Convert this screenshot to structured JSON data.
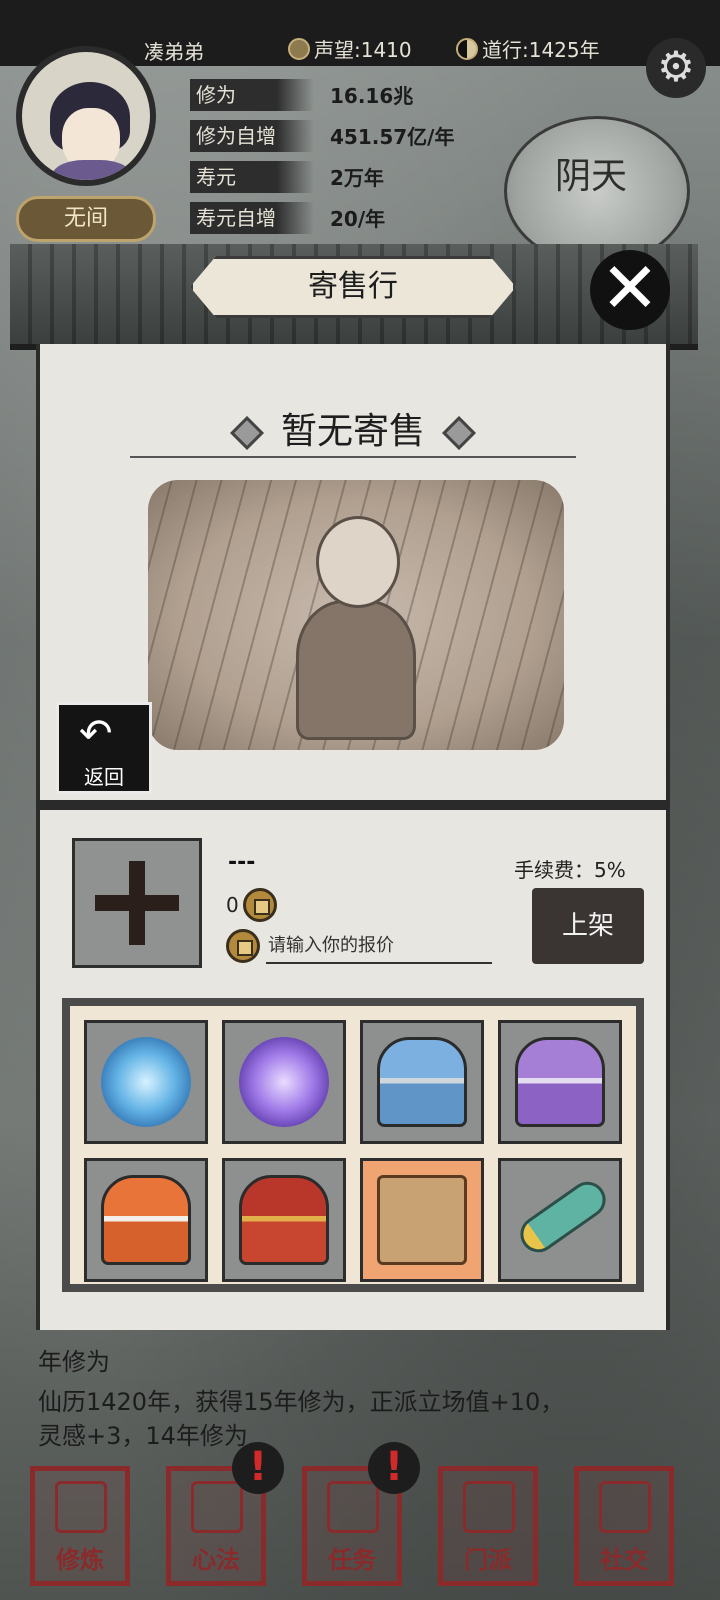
{
  "header": {
    "player_name": "凑弟弟",
    "reputation_label": "声望:1410",
    "dao_label": "道行:1425年",
    "title_badge": "无间"
  },
  "stats": [
    {
      "label": "修为",
      "value": "16.16兆"
    },
    {
      "label": "修为自增",
      "value": "451.57亿/年"
    },
    {
      "label": "寿元",
      "value": "2万年"
    },
    {
      "label": "寿元自增",
      "value": "20/年"
    }
  ],
  "weather": "阴天",
  "panel": {
    "title": "寄售行",
    "empty_title": "暂无寄售",
    "back_label": "返回"
  },
  "listing": {
    "item_name": "---",
    "price": "0",
    "price_placeholder": "请输入你的报价",
    "fee": "手续费：5%",
    "list_button": "上架"
  },
  "inventory": [
    {
      "icon": "blue-portal-icon"
    },
    {
      "icon": "purple-portal-icon"
    },
    {
      "icon": "blue-chest-icon"
    },
    {
      "icon": "purple-chest-icon"
    },
    {
      "icon": "orange-chest-icon"
    },
    {
      "icon": "gold-chest-icon"
    },
    {
      "icon": "map-scroll-icon"
    },
    {
      "icon": "jade-scroll-icon"
    }
  ],
  "log": {
    "line1": "年修为",
    "line2": "仙历1420年，获得15年修为，正派立场值+10，",
    "line3": "灵感+3，14年修为"
  },
  "nav": [
    {
      "label": "修炼",
      "icon": "cultivate-icon"
    },
    {
      "label": "心法",
      "icon": "technique-icon"
    },
    {
      "label": "任务",
      "icon": "task-icon"
    },
    {
      "label": "门派",
      "icon": "sect-icon"
    },
    {
      "label": "社交",
      "icon": "social-icon"
    }
  ],
  "badge_symbol": "!",
  "colors": {
    "accent_red": "#8a2a2a",
    "panel_bg": "#e8e6e0",
    "button_dark": "#3a3432"
  }
}
